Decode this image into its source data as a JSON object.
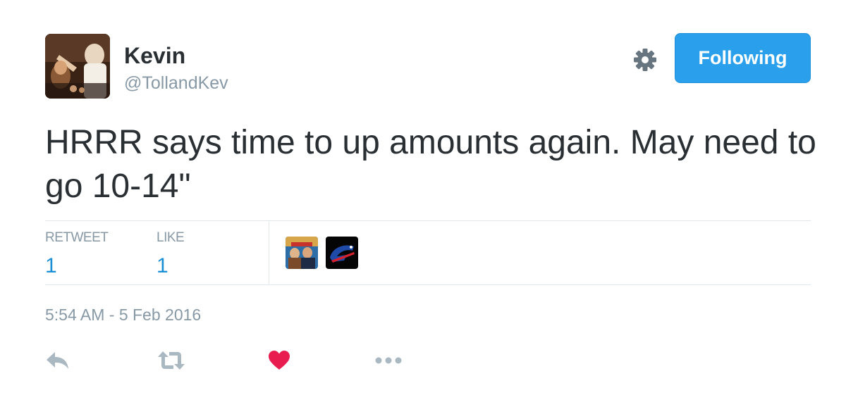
{
  "user": {
    "display_name": "Kevin",
    "handle": "@TollandKev",
    "avatar": "profile-photo"
  },
  "header": {
    "settings_icon": "gear-icon",
    "follow_label": "Following",
    "accent_color": "#2aa0ed"
  },
  "tweet": {
    "text": "HRRR says time to up amounts again. May need to go 10-14\""
  },
  "stats": {
    "retweet_label": "RETWEET",
    "retweet_count": "1",
    "like_label": "LIKE",
    "like_count": "1",
    "likers": [
      "liker-avatar-tv-anchors",
      "liker-avatar-buffalo-bills-logo"
    ]
  },
  "timestamp": "5:54 AM - 5 Feb 2016",
  "actions": {
    "reply_icon": "reply-icon",
    "retweet_icon": "retweet-icon",
    "like_icon": "heart-icon",
    "like_color": "#e81c4f",
    "more_icon": "more-icon"
  }
}
